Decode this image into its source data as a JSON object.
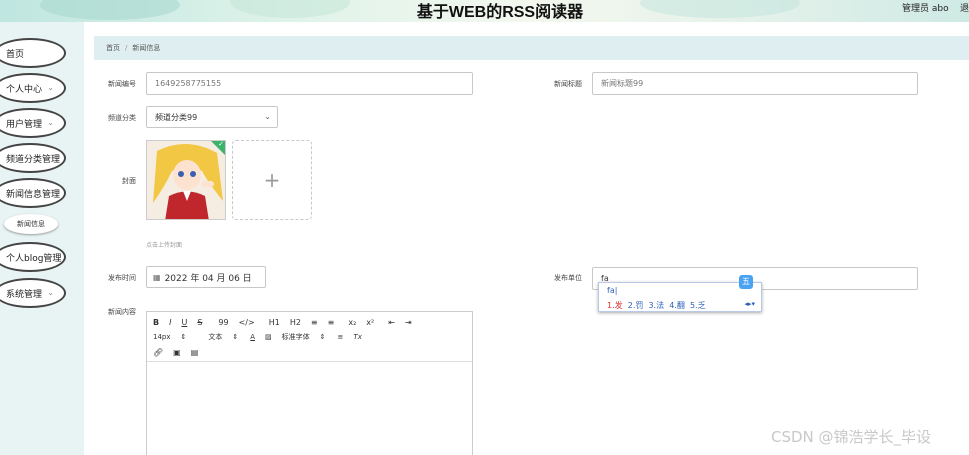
{
  "header": {
    "title": "基于WEB的RSS阅读器",
    "user": "管理员 abo",
    "logout": "退"
  },
  "sidebar": {
    "items": [
      {
        "label": "首页"
      },
      {
        "label": "个人中心"
      },
      {
        "label": "用户管理"
      },
      {
        "label": "频道分类管理"
      },
      {
        "label": "新闻信息管理"
      },
      {
        "label": "新闻信息"
      },
      {
        "label": "个人blog管理"
      },
      {
        "label": "系统管理"
      }
    ]
  },
  "breadcrumb": {
    "home": "首页",
    "separator": "/",
    "current": "新闻信息"
  },
  "form": {
    "news_id_label": "新闻编号",
    "news_id_value": "1649258775155",
    "news_title_label": "新闻标题",
    "news_title_value": "新闻标题99",
    "channel_label": "频道分类",
    "channel_value": "频道分类99",
    "cover_label": "封面",
    "cover_hint": "点击上传封面",
    "upload_plus": "+",
    "publish_time_label": "发布时间",
    "publish_time_value": "2022 年 04 月 06 日",
    "publisher_label": "发布单位",
    "publisher_value": "fa",
    "content_label": "新闻内容"
  },
  "ime": {
    "typed": "fa|",
    "candidates": [
      "1.发",
      "2.罚",
      "3.法",
      "4.翻",
      "5.乏"
    ],
    "logo": "五"
  },
  "editor": {
    "row1": [
      "B",
      "I",
      "U",
      "S",
      "99",
      "</>",
      "H1",
      "H2",
      "≡",
      "≡",
      "x₂",
      "x²",
      "⇤",
      "⇥"
    ],
    "font_size": "14px",
    "text_type": "文本",
    "font_family": "标准字体",
    "clear": "Tx"
  },
  "watermark": "CSDN @锦浩学长_毕设"
}
